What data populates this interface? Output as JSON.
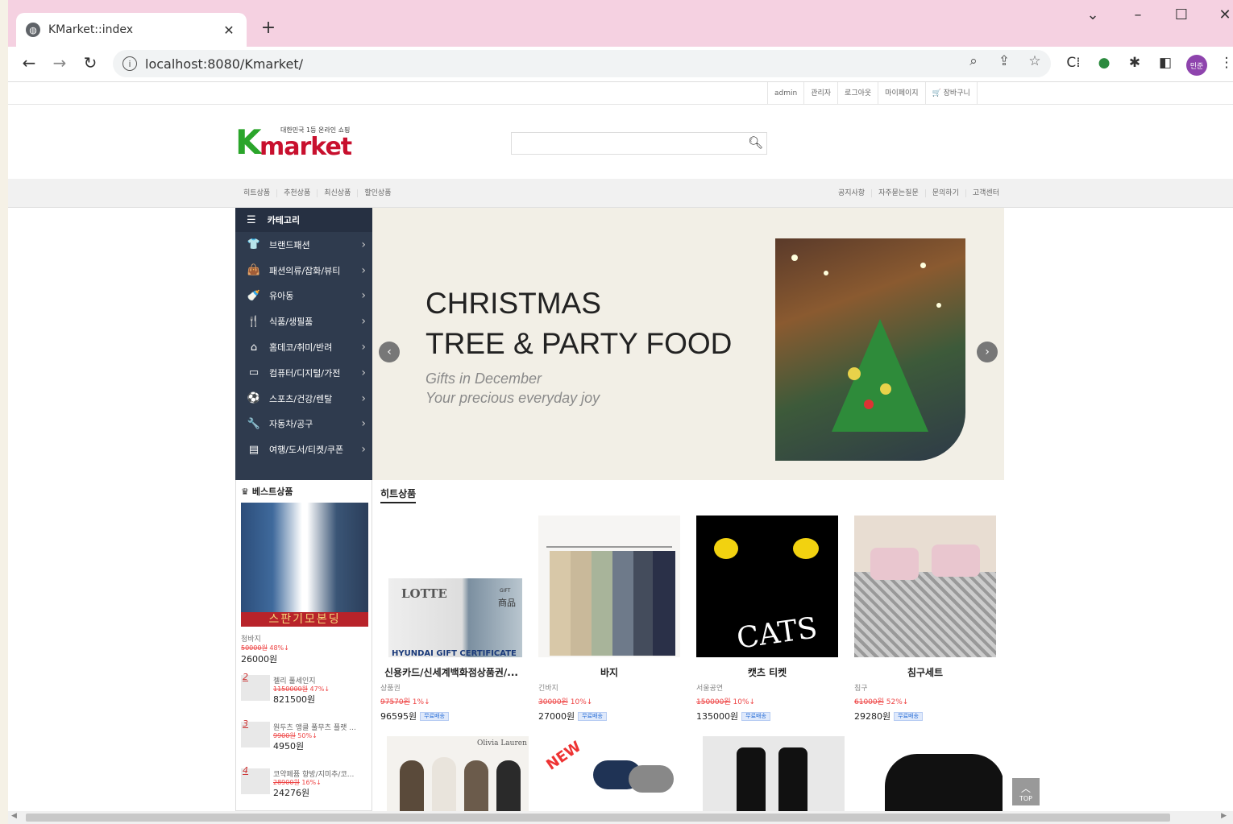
{
  "browser": {
    "tab_title": "KMarket::index",
    "url": "localhost:8080/Kmarket/",
    "profile_label": "민준",
    "colors": {
      "titlebar": "#f5d1e1"
    }
  },
  "top_links": [
    "admin",
    "관리자",
    "로그아웃",
    "마이페이지",
    "장바구니"
  ],
  "logo": {
    "k": "K",
    "rest": "market",
    "tagline": "대한민국 1등 온라인 쇼핑"
  },
  "menu_left": [
    "히트상품",
    "추천상품",
    "최신상품",
    "할인상품"
  ],
  "menu_right": [
    "공지사항",
    "자주묻는질문",
    "문의하기",
    "고객센터"
  ],
  "category": {
    "title": "카테고리",
    "items": [
      {
        "label": "브랜드패션",
        "icon": "shirt-icon",
        "glyph": "👕"
      },
      {
        "label": "패션의류/잡화/뷰티",
        "icon": "bag-icon",
        "glyph": "👜"
      },
      {
        "label": "유아동",
        "icon": "stroller-icon",
        "glyph": "🍼"
      },
      {
        "label": "식품/생필품",
        "icon": "utensils-icon",
        "glyph": "🍴"
      },
      {
        "label": "홈데코/취미/반려",
        "icon": "home-icon",
        "glyph": "⌂"
      },
      {
        "label": "컴퓨터/디지털/가전",
        "icon": "laptop-icon",
        "glyph": "▭"
      },
      {
        "label": "스포츠/건강/렌탈",
        "icon": "ball-icon",
        "glyph": "⚽"
      },
      {
        "label": "자동차/공구",
        "icon": "wrench-icon",
        "glyph": "🔧"
      },
      {
        "label": "여행/도서/티켓/쿠폰",
        "icon": "book-icon",
        "glyph": "▤"
      }
    ]
  },
  "banner": {
    "line1": "CHRISTMAS",
    "line2": "TREE & PARTY FOOD",
    "sub1": "Gifts in December",
    "sub2": "Your precious everyday joy"
  },
  "best": {
    "title": "베스트상품",
    "main": {
      "ribbon": "스판기모본딩",
      "name": "청바지",
      "old_price": "50000원",
      "discount": "48%↓",
      "price": "26000원"
    },
    "items": [
      {
        "rank": "2",
        "name": "젤리 풀세인지",
        "old_price": "1150000원",
        "discount": "47%↓",
        "price": "821500원"
      },
      {
        "rank": "3",
        "name": "원두츠 앵클 풀무츠 플랫 ...",
        "old_price": "9900원",
        "discount": "50%↓",
        "price": "4950원"
      },
      {
        "rank": "4",
        "name": "코약페퓸 향방/지미추/코...",
        "old_price": "28900원",
        "discount": "16%↓",
        "price": "24276원"
      }
    ]
  },
  "hit": {
    "title": "히트상품",
    "products": [
      {
        "title": "신용카드/신세계백화점상품권/...",
        "category": "상품권",
        "old_price": "97570원",
        "discount": "1%↓",
        "price": "96595원",
        "badge": "무료배송",
        "img_text1": "LOTTE",
        "img_text2": "HYUNDAI GIFT CERTIFICATE",
        "img_text3": "GIFT",
        "img_text4": "商品"
      },
      {
        "title": "바지",
        "category": "긴바지",
        "old_price": "30000원",
        "discount": "10%↓",
        "price": "27000원",
        "badge": "무료배송"
      },
      {
        "title": "캣츠 티켓",
        "category": "서울공연",
        "old_price": "150000원",
        "discount": "10%↓",
        "price": "135000원",
        "badge": "무료배송",
        "img_text1": "CATS"
      },
      {
        "title": "침구세트",
        "category": "침구",
        "old_price": "61000원",
        "discount": "52%↓",
        "price": "29280원",
        "badge": "무료배송"
      }
    ],
    "row2_texts": {
      "brand": "Olivia Lauren",
      "new": "NEW"
    }
  },
  "top_button": "TOP"
}
